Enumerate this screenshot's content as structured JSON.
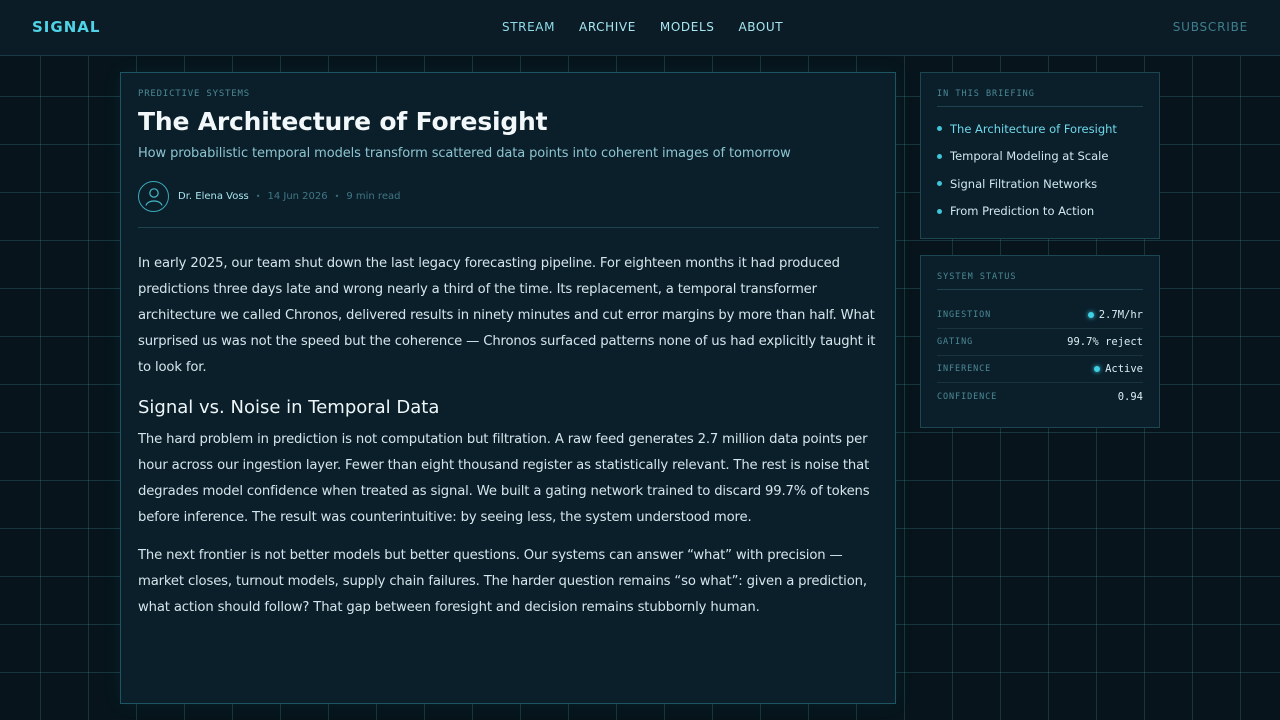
{
  "header": {
    "brand": "SIGNAL",
    "nav": [
      "STREAM",
      "ARCHIVE",
      "MODELS",
      "ABOUT"
    ],
    "subscribe": "SUBSCRIBE"
  },
  "article": {
    "kicker": "PREDICTIVE SYSTEMS",
    "title": "The Architecture of Foresight",
    "subtitle": "How probabilistic temporal models transform scattered data points into coherent images of tomorrow",
    "author": "Dr. Elena Voss",
    "date": "14 Jun 2026",
    "read_time": "9 min read",
    "separator": "•",
    "p1": "In early 2025, our team shut down the last legacy forecasting pipeline. For eighteen months it had produced predictions three days late and wrong nearly a third of the time. Its replacement, a temporal transformer architecture we called Chronos, delivered results in ninety minutes and cut error margins by more than half. What surprised us was not the speed but the coherence — Chronos surfaced patterns none of us had explicitly taught it to look for.",
    "h2": "Signal vs. Noise in Temporal Data",
    "p2": "The hard problem in prediction is not computation but filtration. A raw feed generates 2.7 million data points per hour across our ingestion layer. Fewer than eight thousand register as statistically relevant. The rest is noise that degrades model confidence when treated as signal. We built a gating network trained to discard 99.7% of tokens before inference. The result was counterintuitive: by seeing less, the system understood more.",
    "p3": "The next frontier is not better models but better questions. Our systems can answer “what” with precision — market closes, turnout models, supply chain failures. The harder question remains “so what”: given a prediction, what action should follow? That gap between foresight and decision remains stubbornly human."
  },
  "toc": {
    "title": "IN THIS BRIEFING",
    "items": [
      "The Architecture of Foresight",
      "Temporal Modeling at Scale",
      "Signal Filtration Networks",
      "From Prediction to Action"
    ]
  },
  "status": {
    "title": "SYSTEM STATUS",
    "rows": [
      {
        "label": "INGESTION",
        "value": "2.7M/hr"
      },
      {
        "label": "GATING",
        "value": "99.7% reject"
      },
      {
        "label": "INFERENCE",
        "value": "Active"
      },
      {
        "label": "CONFIDENCE",
        "value": "0.94"
      }
    ]
  },
  "colors": {
    "accent": "#4fd3e6",
    "background": "#07141b",
    "card": "#0b1f2b",
    "status_led": "#3fd0e3"
  },
  "icons": {
    "avatar": "user-icon",
    "bullet": "dot-icon",
    "led": "status-led-icon"
  }
}
